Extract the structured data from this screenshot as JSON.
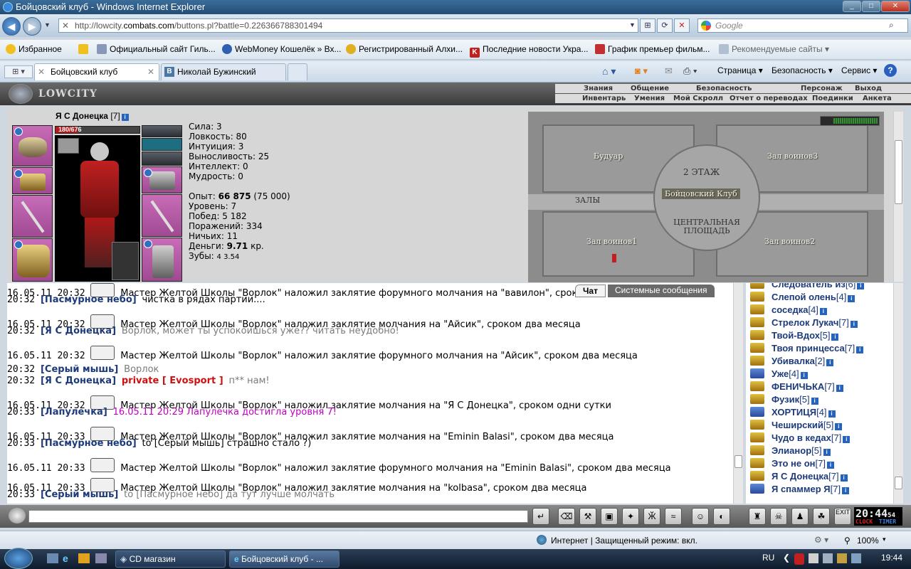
{
  "window": {
    "title": "Бойцовский клуб - Windows Internet Explorer"
  },
  "browser": {
    "address": "http://lowcity.combats.com/buttons.pl?battle=0.226366788301494",
    "address_host": "http://lowcity.",
    "address_bold": "combats.com",
    "address_path": "/buttons.pl?battle=0.226366788301494",
    "search_placeholder": "Google",
    "favorites_label": "Избранное",
    "favorites": [
      "Официальный сайт Гиль...",
      "WebMoney Кошелёк » Вх...",
      "Регистрированный Алхи...",
      "Последние новости Укра...",
      "График премьер фильм...",
      "Рекомендуемые сайты"
    ],
    "tabs": [
      "Бойцовский клуб",
      "Николай Бужинский"
    ],
    "commands": [
      "Страница",
      "Безопасность",
      "Сервис"
    ],
    "status_zone": "Интернет | Защищенный режим: вкл.",
    "zoom": "100%"
  },
  "game": {
    "logo": "LOWCITY",
    "menu_top": [
      "Знания",
      "Общение",
      "Безопасность",
      "Персонаж",
      "Выход"
    ],
    "menu_bottom": [
      "Инвентарь",
      "Умения",
      "Мой Скролл",
      "Отчет о переводах",
      "Поединки",
      "Анкета"
    ],
    "character": {
      "name": "Я С Донецка",
      "level": "[7]",
      "hp": "180/676",
      "hp_fraction": 0.266
    },
    "stats": {
      "strength": "Сила: 3",
      "agility": "Ловкость: 80",
      "intuition": "Интуиция: 3",
      "endurance": "Выносливость: 25",
      "intellect": "Интеллект: 0",
      "wisdom": "Мудрость: 0",
      "exp_label": "Опыт: ",
      "exp_value": "66 875",
      "exp_next": " (75 000)",
      "level": "Уровень: 7",
      "wins": "Побед: 5 182",
      "losses": "Поражений: 334",
      "draws": "Ничьих: 11",
      "money_label": "Деньги: ",
      "money_value": "9.71",
      "money_unit": " кр.",
      "teeth_label": "Зубы: ",
      "teeth_values": "4  3.54"
    },
    "map": {
      "rooms": [
        "Будуар",
        "Зал воинов3",
        "2 ЭТАЖ",
        "Бойцовский Клуб",
        "ЗАЛЫ",
        "ЦЕНТРАЛЬНАЯ ПЛОЩАДЬ",
        "Зал воинов1",
        "Зал воинов2"
      ]
    },
    "chat_tabs": [
      "Чат",
      "Системные сообщения"
    ],
    "chat": [
      {
        "ts": "16.05.11 20:32",
        "icon": true,
        "text": "Мастер Желтой Школы \"Ворлок\" наложил заклятие форумного молчания на \"вавилон\", сроком"
      },
      {
        "ts": "20:32",
        "nick": "Пасмурное небо",
        "text": "чистка в рядах партии...."
      },
      {
        "ts": "16.05.11 20:32",
        "icon": true,
        "text": "Мастер Желтой Школы \"Ворлок\" наложил заклятие молчания на \"Айсик\", сроком два месяца"
      },
      {
        "ts": "20:32",
        "nick": "Я С Донецка",
        "gray": "Ворлок, может ты успокоишься уже?? читать неудобно!"
      },
      {
        "ts": "16.05.11 20:32",
        "icon": true,
        "text": "Мастер Желтой Школы \"Ворлок\" наложил заклятие форумного молчания на \"Айсик\", сроком два месяца"
      },
      {
        "ts": "20:32",
        "nick": "Серый мышь",
        "gray": "Ворлок"
      },
      {
        "ts": "20:32",
        "nick": "Я С Донецка",
        "private": "private [ Evosport ]",
        "gray": "п** нам!"
      },
      {
        "ts": "16.05.11 20:32",
        "icon": true,
        "text": "Мастер Желтой Школы \"Ворлок\" наложил заклятие молчания на \"Я С Донецка\", сроком одни сутки"
      },
      {
        "ts": "20:33",
        "nick": "Лапулечка",
        "magenta": "16.05.11 20:29 Лапулечка достигла уровня 7!"
      },
      {
        "ts": "16.05.11 20:33",
        "icon": true,
        "text": "Мастер Желтой Школы \"Ворлок\" наложил заклятие молчания на \"Eminin Balasi\", сроком два месяца"
      },
      {
        "ts": "20:33",
        "nick": "Пасмурное небо",
        "text": "to [Серый мышь] страшно стало ?)"
      },
      {
        "ts": "16.05.11 20:33",
        "icon": true,
        "text": "Мастер Желтой Школы \"Ворлок\" наложил заклятие форумного молчания на \"Eminin Balasi\", сроком два месяца"
      },
      {
        "ts": "16.05.11 20:33",
        "icon": true,
        "text": "Мастер Желтой Школы \"Ворлок\" наложил заклятие молчания на \"kolbasa\", сроком два месяца"
      },
      {
        "ts": "20:33",
        "nick": "Серый мышь",
        "gray": "to [Пасмурное небо] да тут лучше молчать"
      }
    ],
    "users": [
      {
        "name": "Следователь из",
        "lv": "[6]"
      },
      {
        "name": "Слепой олень",
        "lv": "[4]"
      },
      {
        "name": "соседка",
        "lv": "[4]"
      },
      {
        "name": "Стрелок Лукач",
        "lv": "[7]"
      },
      {
        "name": "Твой-Вдох",
        "lv": "[5]"
      },
      {
        "name": "Твоя принцесса",
        "lv": "[7]"
      },
      {
        "name": "Убивалка",
        "lv": "[2]"
      },
      {
        "name": "Уже",
        "lv": "[4]"
      },
      {
        "name": "ФЕНИЧЬКА",
        "lv": "[7]"
      },
      {
        "name": "Фузик",
        "lv": "[5]"
      },
      {
        "name": "ХОРТИЦЯ",
        "lv": "[4]"
      },
      {
        "name": "Чеширский",
        "lv": "[5]"
      },
      {
        "name": "Чудо в кедах",
        "lv": "[7]"
      },
      {
        "name": "Элианор",
        "lv": "[5]"
      },
      {
        "name": "Это не он",
        "lv": "[7]"
      },
      {
        "name": "Я С Донецка",
        "lv": "[7]"
      },
      {
        "name": "Я спаммер Я",
        "lv": "[7]"
      }
    ],
    "clock": "20:44",
    "clock_sec": "54",
    "clock_labels": [
      "CLOCK",
      "TIMER"
    ]
  },
  "taskbar": {
    "items": [
      "CD магазин",
      "Бойцовский клуб - ..."
    ],
    "lang": "RU",
    "time": "19:44"
  }
}
